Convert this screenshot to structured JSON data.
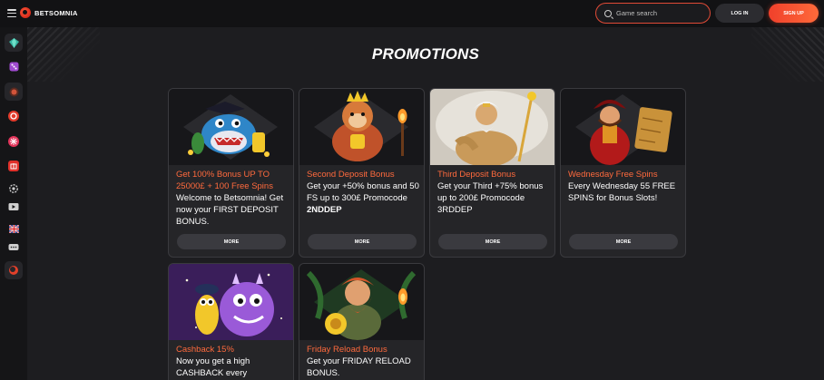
{
  "header": {
    "brand": "BETSOMNIA",
    "search_placeholder": "Game search",
    "login_label": "LOG IN",
    "signup_label": "SIGN UP"
  },
  "sidebar": {
    "items": [
      {
        "icon": "gem-icon",
        "color": "#3fb0a0"
      },
      {
        "icon": "dice-icon",
        "color": "#b05ad8"
      },
      {
        "icon": "slots-icon",
        "color": "#d2543a"
      },
      {
        "icon": "live-casino-icon",
        "color": "#e23a2a"
      },
      {
        "icon": "candy-icon",
        "color": "#e2345a"
      },
      {
        "icon": "gift-icon",
        "color": "#e0302a"
      },
      {
        "icon": "settings-icon",
        "color": "#cfcfcf"
      },
      {
        "icon": "video-icon",
        "color": "#cfcfcf"
      },
      {
        "icon": "uk-flag-icon",
        "color": "#cfcfcf"
      },
      {
        "icon": "chat-icon",
        "color": "#cfcfcf"
      },
      {
        "icon": "brand-icon",
        "color": "#e2402a"
      }
    ]
  },
  "page": {
    "title": "PROMOTIONS",
    "more_label": "MORE"
  },
  "promotions": [
    {
      "title": "Get 100% Bonus UP TO 25000£ + 100 Free Spins",
      "desc": "Welcome to Betsomnia! Get now your FIRST DEPOSIT BONUS.",
      "image": "shark-pirate",
      "bg": "#1f5a8a"
    },
    {
      "title": "Second Deposit Bonus",
      "desc_pre": "Get your +50% bonus and 50 FS up to 300£ Promocode ",
      "desc_code": "2NDDEP",
      "image": "monkey-king",
      "bg": "#7a3a1a"
    },
    {
      "title": "Third Deposit Bonus",
      "desc": "Get your  Third +75% bonus up to 200£ Promocode 3RDDEP",
      "image": "zeus",
      "bg": "#d8d2c8"
    },
    {
      "title": "Wednesday Free Spins",
      "desc": "Every Wednesday 55 FREE SPINS for Bonus Slots!",
      "image": "pirate-captain",
      "bg": "#8a1a1a"
    },
    {
      "title": "Cashback 15%",
      "desc": "Now you get a high CASHBACK every",
      "image": "purple-monster",
      "bg": "#4a2a7a"
    },
    {
      "title": "Friday Reload Bonus",
      "desc": "Get your FRIDAY RELOAD BONUS.",
      "image": "viking",
      "bg": "#2a5a2a"
    }
  ]
}
